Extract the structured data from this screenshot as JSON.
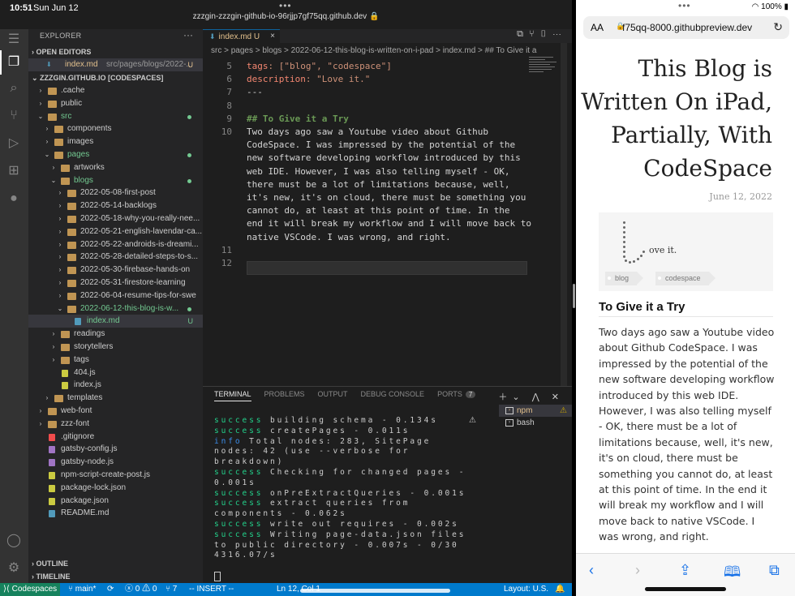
{
  "ios_status": {
    "time": "10:51",
    "date": "Sun Jun 12",
    "multitask_dots": "•••"
  },
  "vscode": {
    "window_url": "zzzgin-zzzgin-github-io-96rjjp7gf75qq.github.dev",
    "explorer_title": "EXPLORER",
    "open_editors_title": "OPEN EDITORS",
    "open_editor": {
      "name": "index.md",
      "path": "src/pages/blogs/2022-...",
      "badge": "U"
    },
    "workspace_title": "ZZZGIN.GITHUB.IO [CODESPACES]",
    "tree": [
      {
        "label": ".cache",
        "depth": 1,
        "type": "folder",
        "open": false
      },
      {
        "label": "public",
        "depth": 1,
        "type": "folder",
        "open": false
      },
      {
        "label": "src",
        "depth": 1,
        "type": "folder",
        "open": true,
        "color": "#73c991",
        "dot": true
      },
      {
        "label": "components",
        "depth": 2,
        "type": "folder",
        "open": false
      },
      {
        "label": "images",
        "depth": 2,
        "type": "folder",
        "open": false
      },
      {
        "label": "pages",
        "depth": 2,
        "type": "folder",
        "open": true,
        "color": "#73c991",
        "dot": true
      },
      {
        "label": "artworks",
        "depth": 3,
        "type": "folder",
        "open": false
      },
      {
        "label": "blogs",
        "depth": 3,
        "type": "folder",
        "open": true,
        "color": "#73c991",
        "dot": true
      },
      {
        "label": "2022-05-08-first-post",
        "depth": 4,
        "type": "folder",
        "open": false
      },
      {
        "label": "2022-05-14-backlogs",
        "depth": 4,
        "type": "folder",
        "open": false
      },
      {
        "label": "2022-05-18-why-you-really-nee...",
        "depth": 4,
        "type": "folder",
        "open": false
      },
      {
        "label": "2022-05-21-english-lavendar-ca...",
        "depth": 4,
        "type": "folder",
        "open": false
      },
      {
        "label": "2022-05-22-androids-is-dreami...",
        "depth": 4,
        "type": "folder",
        "open": false
      },
      {
        "label": "2022-05-28-detailed-steps-to-s...",
        "depth": 4,
        "type": "folder",
        "open": false
      },
      {
        "label": "2022-05-30-firebase-hands-on",
        "depth": 4,
        "type": "folder",
        "open": false
      },
      {
        "label": "2022-05-31-firestore-learning",
        "depth": 4,
        "type": "folder",
        "open": false
      },
      {
        "label": "2022-06-04-resume-tips-for-swe",
        "depth": 4,
        "type": "folder",
        "open": false
      },
      {
        "label": "2022-06-12-this-blog-is-w...",
        "depth": 4,
        "type": "folder",
        "open": true,
        "color": "#73c991",
        "dot": true
      },
      {
        "label": "index.md",
        "depth": 5,
        "type": "md",
        "color": "#73c991",
        "badge": "U",
        "selected": true
      },
      {
        "label": "readings",
        "depth": 3,
        "type": "folder",
        "open": false
      },
      {
        "label": "storytellers",
        "depth": 3,
        "type": "folder",
        "open": false
      },
      {
        "label": "tags",
        "depth": 3,
        "type": "folder",
        "open": false
      },
      {
        "label": "404.js",
        "depth": 3,
        "type": "js"
      },
      {
        "label": "index.js",
        "depth": 3,
        "type": "js"
      },
      {
        "label": "templates",
        "depth": 2,
        "type": "folder",
        "open": false
      },
      {
        "label": "web-font",
        "depth": 1,
        "type": "folder",
        "open": false
      },
      {
        "label": "zzz-font",
        "depth": 1,
        "type": "folder",
        "open": false
      },
      {
        "label": ".gitignore",
        "depth": 1,
        "type": "git"
      },
      {
        "label": "gatsby-config.js",
        "depth": 1,
        "type": "gatsby"
      },
      {
        "label": "gatsby-node.js",
        "depth": 1,
        "type": "gatsby"
      },
      {
        "label": "npm-script-create-post.js",
        "depth": 1,
        "type": "js"
      },
      {
        "label": "package-lock.json",
        "depth": 1,
        "type": "json"
      },
      {
        "label": "package.json",
        "depth": 1,
        "type": "json"
      },
      {
        "label": "README.md",
        "depth": 1,
        "type": "info"
      }
    ],
    "outline_title": "OUTLINE",
    "timeline_title": "TIMELINE",
    "tab": {
      "name": "index.md",
      "badge": "U"
    },
    "breadcrumb": "src > pages > blogs > 2022-06-12-this-blog-is-written-on-i-pad > index.md > ## To Give it a",
    "code_lines": [
      {
        "n": "5",
        "key": "tags",
        "rest": ": [\"blog\", \"codespace\"]"
      },
      {
        "n": "6",
        "key": "description",
        "rest": ": \"Love it.\""
      },
      {
        "n": "7",
        "text": "---"
      },
      {
        "n": "8",
        "text": ""
      },
      {
        "n": "9",
        "heading": "## To Give it a Try"
      },
      {
        "n": "10",
        "wrapped": [
          "Two days ago saw a Youtube video about Github",
          "CodeSpace. I was impressed by the potential of the",
          "new software developing workflow introduced by this",
          "web IDE. However, I was also telling myself - OK,",
          "there must be a lot of limitations because, well,",
          "it's new, it's on cloud, there must be something you",
          "cannot do, at least at this point of time. In the",
          "end it will break my workflow and I will move back to",
          "native VSCode. I was wrong, and right."
        ]
      },
      {
        "n": "11",
        "text": ""
      },
      {
        "n": "12",
        "text": ""
      }
    ],
    "panel_tabs": [
      "TERMINAL",
      "PROBLEMS",
      "OUTPUT",
      "DEBUG CONSOLE",
      "PORTS"
    ],
    "ports_count": "7",
    "terminal_lines": [
      {
        "k": "success",
        "t": " building schema - 0.134s"
      },
      {
        "k": "success",
        "t": " createPages - 0.011s"
      },
      {
        "k": "info",
        "t": " Total nodes: 283, SitePage"
      },
      {
        "k": "",
        "t": "nodes: 42 (use --verbose for"
      },
      {
        "k": "",
        "t": "breakdown)"
      },
      {
        "k": "success",
        "t": " Checking for changed pages -"
      },
      {
        "k": "",
        "t": " 0.001s"
      },
      {
        "k": "success",
        "t": " onPreExtractQueries - 0.001s"
      },
      {
        "k": "success",
        "t": " extract queries from"
      },
      {
        "k": "",
        "t": "components - 0.062s"
      },
      {
        "k": "success",
        "t": " write out requires - 0.002s"
      },
      {
        "k": "success",
        "t": " Writing page-data.json files"
      },
      {
        "k": "",
        "t": " to public directory - 0.007s - 0/30"
      },
      {
        "k": "",
        "t": "4316.07/s"
      }
    ],
    "terminals": [
      {
        "name": "npm",
        "selected": true,
        "warn": true
      },
      {
        "name": "bash",
        "selected": false
      }
    ],
    "statusbar": {
      "remote": "Codespaces",
      "branch": "main*",
      "errors": "0",
      "warnings": "0",
      "ports": "7",
      "mode": "-- INSERT --",
      "position": "Ln 12, Col 1",
      "layout": "Layout: U.S."
    }
  },
  "safari": {
    "address": "f75qq-8000.githubpreview.dev",
    "aa_label": "AA",
    "post_title": "This Blog is Written On iPad, Partially, With CodeSpace",
    "post_date": "June 12, 2022",
    "logo_text": "ove it.",
    "tags": [
      "blog",
      "codespace"
    ],
    "section_heading": "To Give it a Try",
    "paragraph": "Two days ago saw a Youtube video about Github CodeSpace. I was impressed by the potential of the new software developing workflow introduced by this web IDE. However, I was also telling myself - OK, there must be a lot of limitations because, well, it's new, it's on cloud, there must be something you cannot do, at least at this point of time. In the end it will break my workflow and I will move back to native VSCode. I was wrong, and right."
  }
}
